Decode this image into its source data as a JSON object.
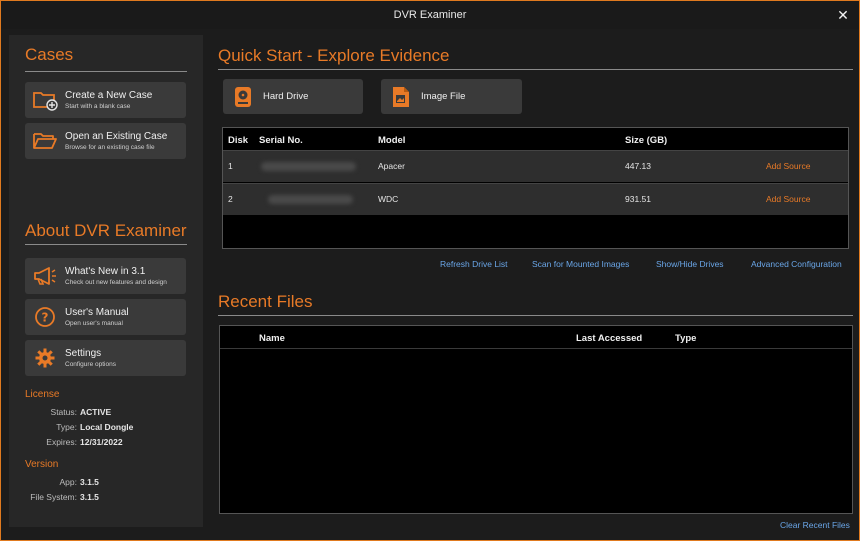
{
  "window": {
    "title": "DVR Examiner",
    "close": "✕"
  },
  "sidebar": {
    "cases_heading": "Cases",
    "create": {
      "title": "Create a New Case",
      "subtitle": "Start with a blank case"
    },
    "open": {
      "title": "Open an Existing Case",
      "subtitle": "Browse for an existing case file"
    },
    "about_heading": "About DVR Examiner",
    "whats_new": {
      "title": "What's New in 3.1",
      "subtitle": "Check out new features and design"
    },
    "manual": {
      "title": "User's Manual",
      "subtitle": "Open user's manual"
    },
    "settings": {
      "title": "Settings",
      "subtitle": "Configure options"
    },
    "license": {
      "heading": "License",
      "status_label": "Status:",
      "status_value": "ACTIVE",
      "type_label": "Type:",
      "type_value": "Local Dongle",
      "expires_label": "Expires:",
      "expires_value": "12/31/2022"
    },
    "version": {
      "heading": "Version",
      "app_label": "App:",
      "app_value": "3.1.5",
      "fs_label": "File System:",
      "fs_value": "3.1.5"
    }
  },
  "quick_start": {
    "heading": "Quick Start - Explore Evidence",
    "hard_drive": "Hard Drive",
    "image_file": "Image File",
    "columns": {
      "disk": "Disk",
      "serial": "Serial No.",
      "model": "Model",
      "size": "Size (GB)"
    },
    "rows": [
      {
        "disk": "1",
        "model": "Apacer",
        "size": "447.13",
        "action": "Add Source"
      },
      {
        "disk": "2",
        "model": "WDC",
        "size": "931.51",
        "action": "Add Source"
      }
    ],
    "links": {
      "refresh": "Refresh Drive List",
      "scan": "Scan for Mounted Images",
      "showhide": "Show/Hide Drives",
      "advanced": "Advanced Configuration"
    }
  },
  "recent": {
    "heading": "Recent Files",
    "columns": {
      "name": "Name",
      "last_accessed": "Last Accessed",
      "type": "Type"
    },
    "clear": "Clear Recent Files"
  },
  "colors": {
    "accent": "#e87a27",
    "link": "#6aa6e8",
    "panel": "#272727",
    "button": "#3a3a3a"
  }
}
